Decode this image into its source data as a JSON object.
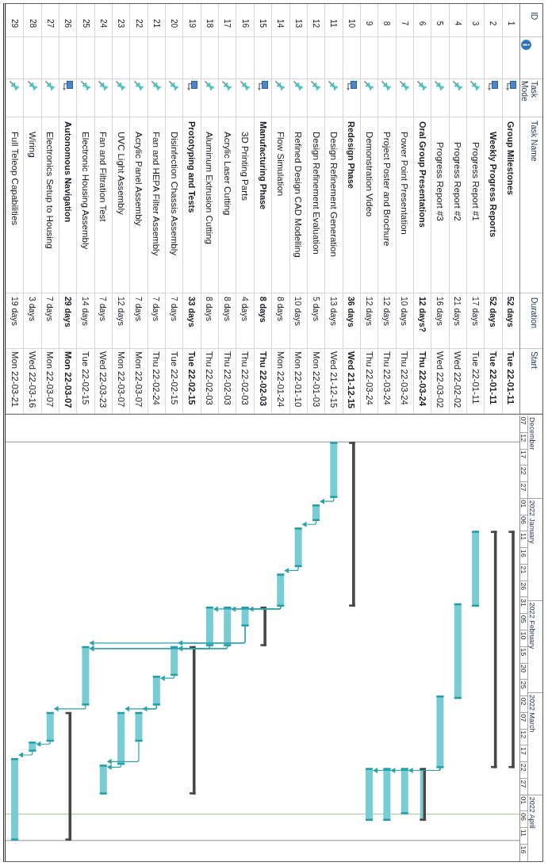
{
  "columns": [
    {
      "kind": "id",
      "label": "ID"
    },
    {
      "kind": "indicators"
    },
    {
      "kind": "mode",
      "label": "Task Mode"
    },
    {
      "kind": "name",
      "label": "Task Name"
    },
    {
      "kind": "duration",
      "label": "Duration"
    },
    {
      "kind": "start",
      "label": "Start"
    }
  ],
  "timescale": {
    "months": [
      "December",
      "2022 January",
      "2022 February",
      "2022 March",
      "2022 April"
    ],
    "days": [
      "07",
      "12",
      "17",
      "22",
      "27",
      "01",
      "06",
      "11",
      "16",
      "21",
      "26",
      "31",
      "05",
      "10",
      "15",
      "20",
      "25",
      "02",
      "07",
      "12",
      "17",
      "22",
      "27",
      "01",
      "06",
      "11",
      "16"
    ]
  },
  "tasks": [
    {
      "id": "1",
      "kind": "auto",
      "name": "Group Milestones",
      "duration": "52 days",
      "start": "Tue 22-01-11",
      "children": [
        {
          "id": "2",
          "kind": "auto",
          "name": "Weekly Progress Reports",
          "duration": "52 days",
          "start": "Tue 22-01-11",
          "children": [
            {
              "id": "3",
              "kind": "manual",
              "name": "Progress Report #1",
              "duration": "17 days",
              "start": "Tue 22-01-11"
            },
            {
              "id": "4",
              "kind": "manual",
              "name": "Progress Report #2",
              "duration": "21 days",
              "start": "Wed 22-02-02"
            },
            {
              "id": "5",
              "kind": "manual",
              "name": "Progress Report #3",
              "duration": "16 days",
              "start": "Wed 22-03-02"
            }
          ]
        }
      ]
    },
    {
      "id": "6",
      "kind": "manual",
      "name": "Oral Group Presentations",
      "duration": "12 days?",
      "start": "Thu 22-03-24",
      "children": [
        {
          "id": "7",
          "kind": "manual",
          "name": "Power Point Presentation",
          "duration": "10 days",
          "start": "Thu 22-03-24",
          "predecessors": {
            "task_5": true
          }
        },
        {
          "id": "8",
          "kind": "manual",
          "name": "Project Poster and Brochure",
          "duration": "12 days",
          "start": "Thu 22-03-24",
          "predecessors": {
            "task_5": true
          }
        },
        {
          "id": "9",
          "kind": "manual",
          "name": "Demonstration Video",
          "duration": "12 days",
          "start": "Thu 22-03-24",
          "predecessors": {
            "task_5": true
          }
        }
      ]
    },
    {
      "id": "10",
      "kind": "auto",
      "name": "Redesign Phase",
      "duration": "36 days",
      "start": "Wed 21-12-15",
      "children": [
        {
          "id": "11",
          "kind": "manual",
          "name": "Design Refinement Generation",
          "duration": "13 days",
          "start": "Wed 21-12-15"
        },
        {
          "id": "12",
          "kind": "manual",
          "name": "Design Refinement Evaluation",
          "duration": "5 days",
          "start": "Mon 22-01-03",
          "predecessors": {
            "task_11": true
          }
        },
        {
          "id": "13",
          "kind": "manual",
          "name": "Refined Design CAD Modelling",
          "duration": "10 days",
          "start": "Mon 22-01-10",
          "predecessors": {
            "task_12": true
          }
        },
        {
          "id": "14",
          "kind": "manual",
          "name": "Flow Simulation",
          "duration": "8 days",
          "start": "Mon 22-01-24",
          "predecessors": {
            "task_13": true
          }
        }
      ]
    },
    {
      "id": "15",
      "kind": "auto",
      "name": "Manufacturing Phase",
      "duration": "8 days",
      "start": "Thu 22-02-03",
      "children": [
        {
          "id": "16",
          "kind": "manual",
          "name": "3D Printing Parts",
          "duration": "4 days",
          "start": "Thu 22-02-03",
          "predecessors": {
            "task_14": true
          }
        },
        {
          "id": "17",
          "kind": "manual",
          "name": "Acrylic Laser Cutting",
          "duration": "8 days",
          "start": "Thu 22-02-03",
          "predecessors": {
            "task_14": true
          }
        },
        {
          "id": "18",
          "kind": "manual",
          "name": "Aluminum Extrusion Cutting",
          "duration": "8 days",
          "start": "Thu 22-02-03",
          "predecessors": {
            "task_14": true
          }
        }
      ]
    },
    {
      "id": "19",
      "kind": "auto",
      "name": "Prototyping and Tests",
      "duration": "33 days",
      "start": "Tue 22-02-15",
      "children": [
        {
          "id": "20",
          "kind": "manual",
          "name": "Disinfection Chassis Assembly",
          "duration": "7 days",
          "start": "Tue 22-02-15",
          "predecessors": {
            "task_16": true,
            "task_17": true,
            "task_18": true
          }
        },
        {
          "id": "21",
          "kind": "manual",
          "name": "Fan and HEPA Filter Assembly",
          "duration": "7 days",
          "start": "Thu 22-02-24",
          "predecessors": {
            "task_20": true
          }
        },
        {
          "id": "22",
          "kind": "manual",
          "name": "Acrylic Panel Assembly",
          "duration": "7 days",
          "start": "Mon 22-03-07",
          "predecessors": {
            "task_21": true
          }
        },
        {
          "id": "23",
          "kind": "manual",
          "name": "UVC Light Assembly",
          "duration": "12 days",
          "start": "Mon 22-03-07",
          "predecessors": {
            "task_21": true
          }
        },
        {
          "id": "24",
          "kind": "manual",
          "name": "Fan and Filtration Test",
          "duration": "7 days",
          "start": "Wed 22-03-23",
          "predecessors": {
            "task_22": true,
            "task_23": true
          }
        },
        {
          "id": "25",
          "kind": "manual",
          "name": "Electronic Housing Assembly",
          "duration": "14 days",
          "start": "Tue 22-02-15",
          "predecessors": {
            "task_16": true,
            "task_17": true,
            "task_18": true
          }
        }
      ]
    },
    {
      "id": "26",
      "kind": "auto",
      "name": "Autonomous Navigation",
      "duration": "29 days",
      "start": "Mon 22-03-07",
      "children": [
        {
          "id": "27",
          "kind": "manual",
          "name": "Electronics Setup to Housing",
          "duration": "7 days",
          "start": "Mon 22-03-07",
          "predecessors": {
            "task_25": true
          }
        },
        {
          "id": "28",
          "kind": "manual",
          "name": "Wiring",
          "duration": "3 days",
          "start": "Wed 22-03-16",
          "predecessors": {
            "task_27": true
          }
        },
        {
          "id": "29",
          "kind": "manual",
          "name": "Full Teleop Capabilities",
          "duration": "19 days",
          "start": "Mon 22-03-21",
          "predecessors": {
            "task_28": true
          }
        }
      ]
    }
  ]
}
